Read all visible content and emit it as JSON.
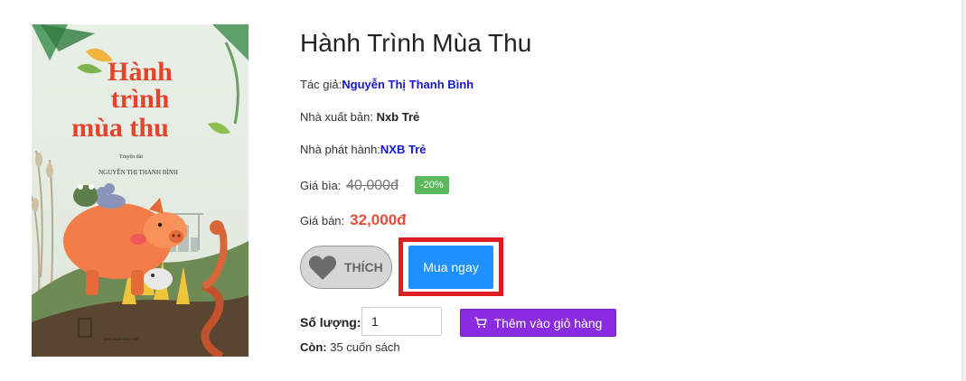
{
  "product": {
    "title": "Hành Trình Mùa Thu",
    "author_label": "Tác giả:",
    "author": "Nguyễn Thị Thanh Bình",
    "publisher_label": "Nhà xuất bản: ",
    "publisher": "Nxb Trẻ",
    "distributor_label": "Nhà phát hành:",
    "distributor": "NXB Trẻ",
    "cover_price_label": "Giá bìa: ",
    "cover_price": "40,000đ",
    "discount_badge": "-20%",
    "sale_price_label": "Giá bán:",
    "sale_price": "32,000đ"
  },
  "cover_image": {
    "title_line1": "Hành",
    "title_line2": "trình",
    "title_line3": "mùa thu",
    "subtitle": "Truyện dài",
    "author": "NGUYỄN THỊ THANH BÌNH",
    "publisher_mark": "NHÀ XUẤT BẢN TRẺ"
  },
  "actions": {
    "like_label": "THÍCH",
    "buy_now_label": "Mua ngay",
    "quantity_label": "Số lượng:",
    "quantity_value": "1",
    "add_to_cart_label": "Thêm vào giỏ hàng"
  },
  "stock": {
    "label": "Còn:",
    "value": " 35 cuốn sách"
  },
  "colors": {
    "title_link": "#1515d6",
    "sale_price": "#e74c3c",
    "discount_badge": "#5cb85c",
    "buy_button": "#1e90ff",
    "cart_button": "#8a2be2",
    "highlight_box": "#e11d24"
  },
  "icons": {
    "like": "heart-icon",
    "cart": "cart-icon"
  }
}
